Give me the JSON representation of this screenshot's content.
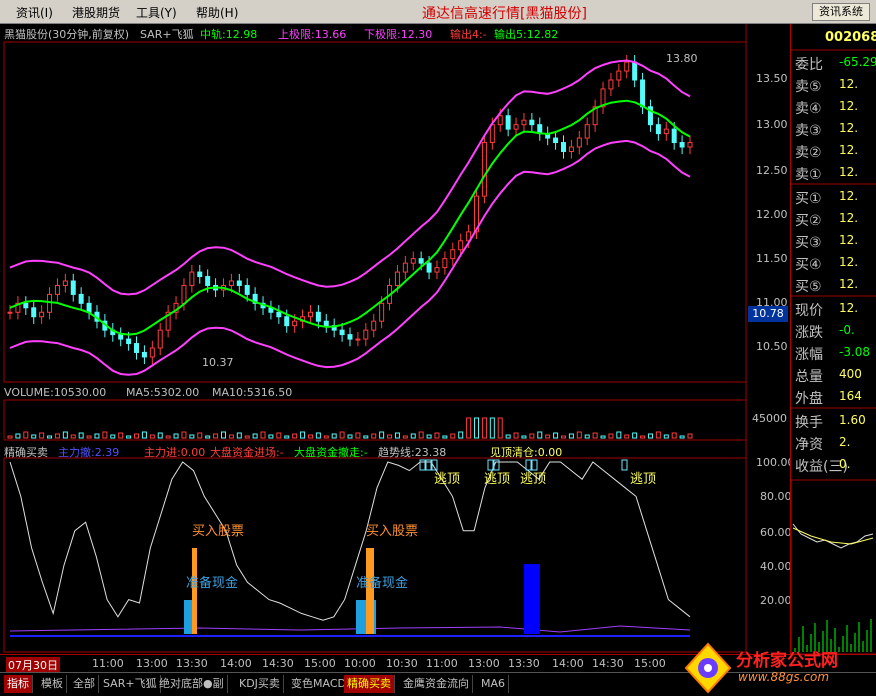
{
  "menu": {
    "items": [
      "资讯(I)",
      "港股期货",
      "工具(Y)",
      "帮助(H)"
    ],
    "title": "通达信高速行情[黑猫股份]",
    "sys_button": "资讯系统"
  },
  "main_header": {
    "stock": "黑猫股份(30分钟,前复权)",
    "indicator": "SAR+飞狐",
    "mid": "中轨:12.98",
    "upper": "上极限:13.66",
    "lower": "下极限:12.30",
    "out4": "输出4:-",
    "out5": "输出5:12.82"
  },
  "volume_header": {
    "vol": "VOLUME:10530.00",
    "ma5": "MA5:5302.00",
    "ma10": "MA10:5316.50"
  },
  "ind_header": {
    "name": "精确买卖",
    "main_down": "主力撤:2.39",
    "main_up": "主力进:0.00",
    "big_in": "大盘资金进场:-",
    "big_out": "大盘资金撤走:-",
    "trend": "趋势线:23.38",
    "clear": "见顶清仓:0.00"
  },
  "annotations": {
    "buy": "买入股票",
    "cash": "准备现金",
    "escape": "逃顶",
    "high": "13.80",
    "low": "10.37",
    "current": "10.78"
  },
  "price_axis": [
    "13.50",
    "13.00",
    "12.50",
    "12.00",
    "11.50",
    "11.00",
    "10.50"
  ],
  "vol_axis": [
    "45000"
  ],
  "ind_axis": [
    "100.00",
    "80.00",
    "60.00",
    "40.00",
    "20.00"
  ],
  "time_axis": [
    "07月30日",
    "11:00",
    "13:00",
    "13:30",
    "14:00",
    "14:30",
    "15:00",
    "10:00",
    "10:30",
    "11:00",
    "13:00",
    "13:30",
    "14:00",
    "14:30",
    "15:00"
  ],
  "right_panel": {
    "code": "002068",
    "rows": [
      {
        "label": "委比",
        "value": "-65.29"
      },
      {
        "label": "卖⑤",
        "value": "12."
      },
      {
        "label": "卖④",
        "value": "12."
      },
      {
        "label": "卖③",
        "value": "12."
      },
      {
        "label": "卖②",
        "value": "12."
      },
      {
        "label": "卖①",
        "value": "12."
      },
      {
        "label": "买①",
        "value": "12."
      },
      {
        "label": "买②",
        "value": "12."
      },
      {
        "label": "买③",
        "value": "12."
      },
      {
        "label": "买④",
        "value": "12."
      },
      {
        "label": "买⑤",
        "value": "12."
      },
      {
        "label": "现价",
        "value": "12."
      },
      {
        "label": "涨跌",
        "value": "-0."
      },
      {
        "label": "涨幅",
        "value": "-3.08"
      },
      {
        "label": "总量",
        "value": "400"
      },
      {
        "label": "外盘",
        "value": "164"
      },
      {
        "label": "换手",
        "value": "1.60"
      },
      {
        "label": "净资",
        "value": "2."
      },
      {
        "label": "收益(三)",
        "value": "0."
      }
    ]
  },
  "tabs": [
    "指标",
    "模板",
    "全部",
    "SAR+飞狐",
    "绝对底部●副",
    "KDJ买卖",
    "变色MACD",
    "精确买卖",
    "金鹰资金流向",
    "MA6"
  ],
  "active_tab": 7,
  "watermark": {
    "title": "分析家公式网",
    "url": "www.88gs.com"
  },
  "colors": {
    "up": "#ff3c3c",
    "down": "#54fcfc",
    "mid": "#00ff00",
    "band": "#ff40ff",
    "accent_red": "#a00000"
  }
}
